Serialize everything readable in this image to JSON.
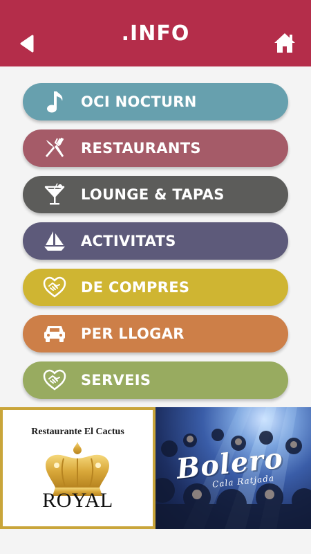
{
  "header": {
    "title": ".INFO",
    "back_icon": "back-arrow-icon",
    "home_icon": "home-icon",
    "background_color": "#b42d4a"
  },
  "menu": {
    "items": [
      {
        "label": "OCI NOCTURN",
        "icon": "music-note-icon",
        "color": "#67a0ae"
      },
      {
        "label": "RESTAURANTS",
        "icon": "fork-knife-icon",
        "color": "#a55b68"
      },
      {
        "label": "LOUNGE & TAPAS",
        "icon": "cocktail-glass-icon",
        "color": "#5c5c5a"
      },
      {
        "label": "ACTIVITATS",
        "icon": "sailboat-icon",
        "color": "#5d5a7a"
      },
      {
        "label": "DE COMPRES",
        "icon": "handshake-heart-icon",
        "color": "#cfb532"
      },
      {
        "label": "PER LLOGAR",
        "icon": "car-icon",
        "color": "#cd7f48"
      },
      {
        "label": "SERVEIS",
        "icon": "handshake-heart-icon",
        "color": "#98ab60"
      }
    ]
  },
  "banners": {
    "royal": {
      "name": "Restaurante El Cactus",
      "title": "ROYAL"
    },
    "bolero": {
      "title": "Bolero",
      "subtitle": "Cala Ratjada"
    }
  }
}
